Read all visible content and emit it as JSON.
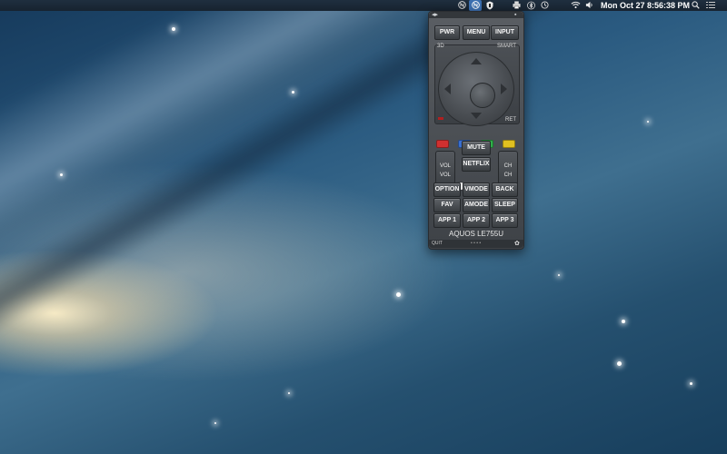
{
  "menubar": {
    "datetime": "Mon Oct 27  8:56:38 PM",
    "icons": [
      "n-app-icon",
      "n-active-icon",
      "shield-icon",
      "printer-icon",
      "bluetooth-icon",
      "time-machine-icon",
      "wifi-icon",
      "volume-icon",
      "search-icon",
      "list-icon"
    ]
  },
  "remote": {
    "top_left_icon": "arrows-icon",
    "top_right_icon": "lock-icon",
    "buttons": {
      "pwr": "PWR",
      "menu": "MENU",
      "input": "INPUT",
      "mute": "MUTE",
      "netflix": "NETFLIX",
      "option": "OPTION",
      "vmode": "VMODE",
      "back": "BACK",
      "fav": "FAV",
      "amode": "AMODE",
      "sleep": "SLEEP",
      "app1": "APP 1",
      "app2": "APP 2",
      "app3": "APP 3"
    },
    "pad_labels": {
      "three_d": "3D",
      "smart": "SMART",
      "ret": "RET"
    },
    "vol": {
      "up": "VOL",
      "down": "VOL"
    },
    "ch": {
      "up": "CH",
      "down": "CH"
    },
    "model": "AQUOS LE755U",
    "quit": "QUIT",
    "colors": {
      "red": "#d03030",
      "blue": "#3a6fd0",
      "green": "#2fb04a",
      "yellow": "#e0c020"
    }
  }
}
